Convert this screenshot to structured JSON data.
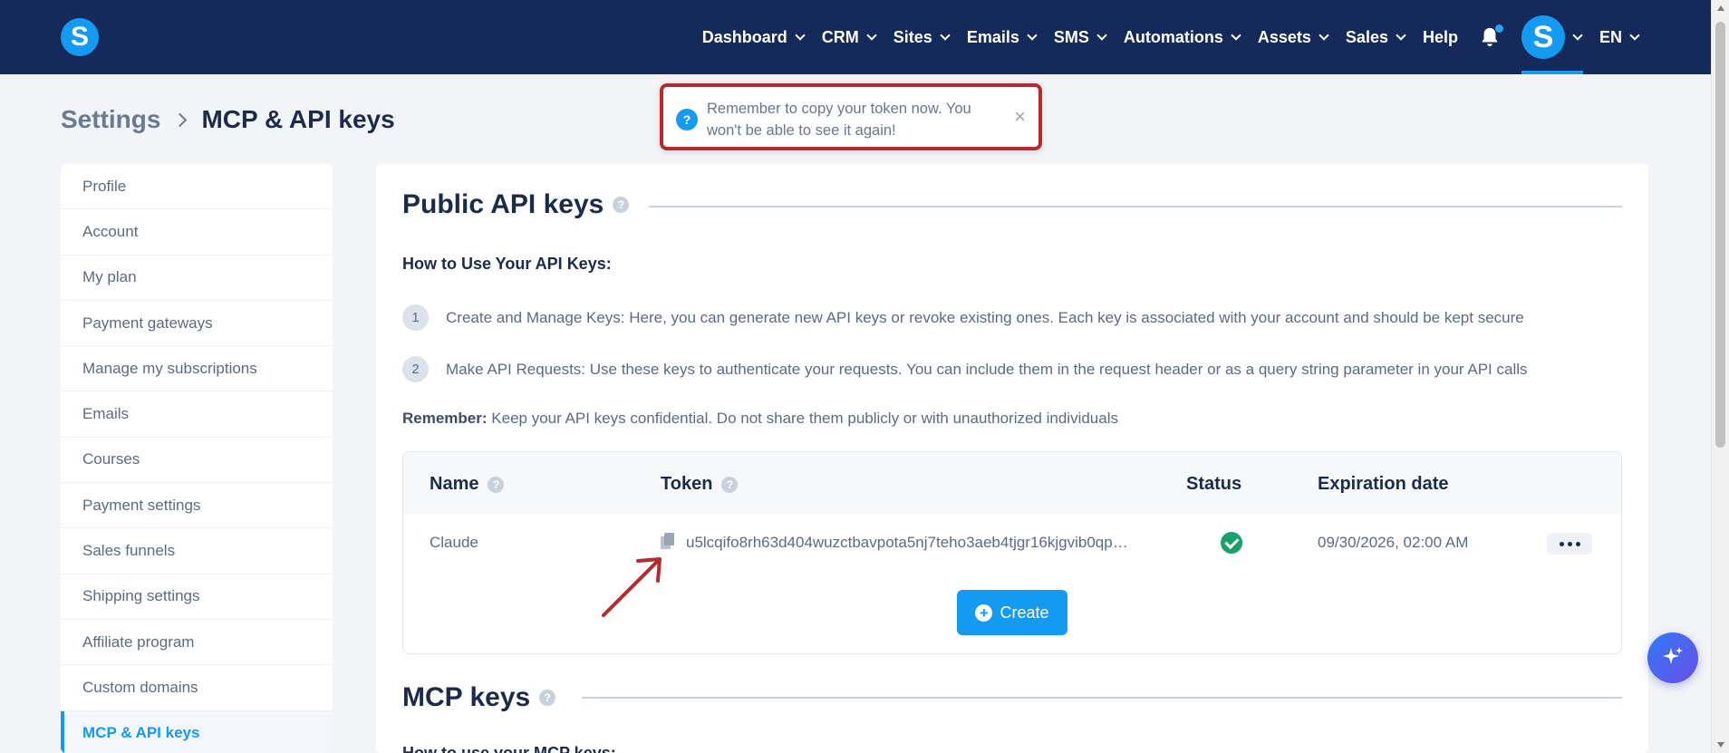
{
  "nav": {
    "logo": "S",
    "items": [
      {
        "label": "Dashboard"
      },
      {
        "label": "CRM"
      },
      {
        "label": "Sites"
      },
      {
        "label": "Emails"
      },
      {
        "label": "SMS"
      },
      {
        "label": "Automations"
      },
      {
        "label": "Assets"
      },
      {
        "label": "Sales"
      }
    ],
    "help": "Help",
    "avatar": "S",
    "language": "EN"
  },
  "breadcrumb": {
    "parent": "Settings",
    "current": "MCP & API keys"
  },
  "toast": {
    "icon": "?",
    "message": "Remember to copy your token now. You won't be able to see it again!",
    "close": "×"
  },
  "sidebar": {
    "items": [
      {
        "label": "Profile"
      },
      {
        "label": "Account"
      },
      {
        "label": "My plan"
      },
      {
        "label": "Payment gateways"
      },
      {
        "label": "Manage my subscriptions"
      },
      {
        "label": "Emails"
      },
      {
        "label": "Courses"
      },
      {
        "label": "Payment settings"
      },
      {
        "label": "Sales funnels"
      },
      {
        "label": "Shipping settings"
      },
      {
        "label": "Affiliate program"
      },
      {
        "label": "Custom domains"
      },
      {
        "label": "MCP & API keys"
      }
    ]
  },
  "public_api": {
    "title": "Public API keys",
    "howto": "How to Use Your API Keys:",
    "steps": [
      {
        "num": "1",
        "text": "Create and Manage Keys: Here, you can generate new API keys or revoke existing ones. Each key is associated with your account and should be kept secure"
      },
      {
        "num": "2",
        "text": "Make API Requests: Use these keys to authenticate your requests. You can include them in the request header or as a query string parameter in your API calls"
      }
    ],
    "remember_label": "Remember:",
    "remember_text": " Keep your API keys confidential. Do not share them publicly or with unauthorized individuals",
    "table": {
      "headers": {
        "name": "Name",
        "token": "Token",
        "status": "Status",
        "expiration": "Expiration date"
      },
      "rows": [
        {
          "name": "Claude",
          "token": "u5lcqifo8rh63d404wuzctbavpota5nj7teho3aeb4tjgr16kjgvib0qp…",
          "status": "active",
          "expiration": "09/30/2026, 02:00 AM"
        }
      ]
    },
    "create_label": "Create"
  },
  "mcp": {
    "title": "MCP keys",
    "howto": "How to use your MCP keys:"
  },
  "colors": {
    "nav_bg": "#152a5a",
    "accent": "#149af0",
    "toast_border": "#b52a2e",
    "status_ok": "#1aa06b"
  }
}
